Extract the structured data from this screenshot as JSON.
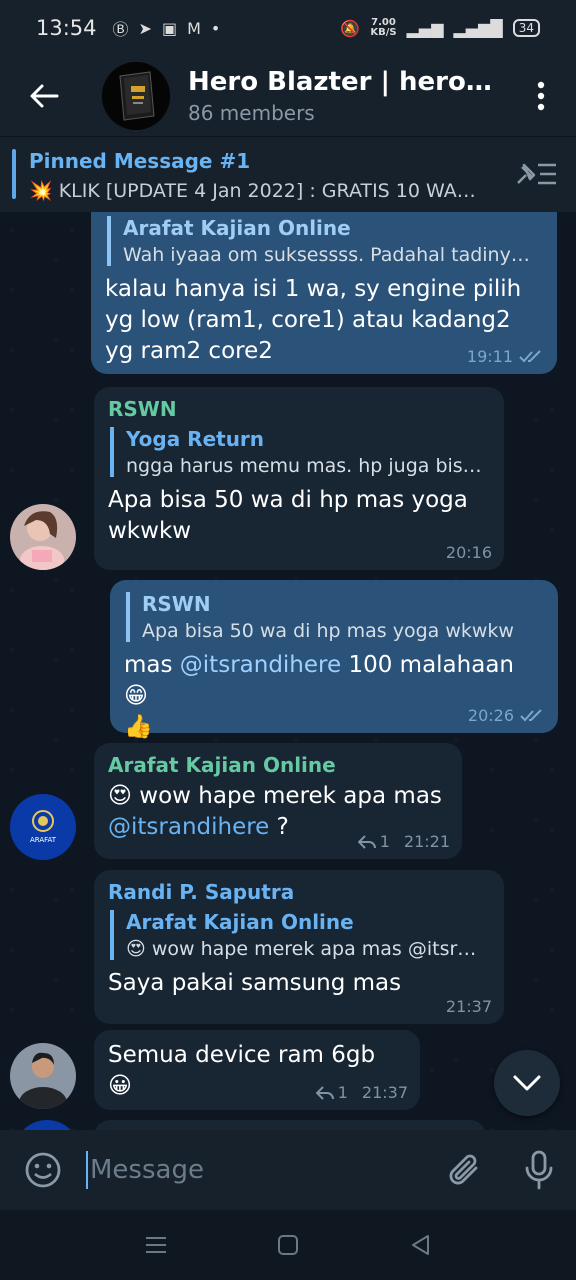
{
  "status": {
    "time": "13:54",
    "net_speed_value": "7.00",
    "net_speed_unit": "KB/S",
    "battery": "34"
  },
  "header": {
    "title": "Hero Blazter | herobla…",
    "subtitle": "86 members"
  },
  "pinned": {
    "title": "Pinned Message #1",
    "text": "💥 KLIK [UPDATE 4 Jan 2022] : GRATIS 10 WA…"
  },
  "messages": [
    {
      "reply_name": "Arafat Kajian Online",
      "reply_text": "Wah iyaaa om suksessss. Padahal tadiny…",
      "text": "kalau hanya isi 1 wa, sy engine pilih yg low (ram1, core1) atau kadang2 yg ram2 core2",
      "time": "19:11"
    },
    {
      "sender": "RSWN",
      "reply_name": "Yoga Return",
      "reply_text": "ngga harus memu mas. hp juga bis…",
      "text": "Apa bisa 50 wa di hp mas yoga wkwkw",
      "time": "20:16"
    },
    {
      "reply_name": "RSWN",
      "reply_text": "Apa bisa 50 wa di hp mas yoga wkwkw",
      "text_a": "mas ",
      "mention": "@itsrandihere",
      "text_b": " 100 malahaan 😁",
      "text_c": "👍",
      "time": "20:26"
    },
    {
      "sender": "Arafat Kajian Online",
      "text_a": "😍 wow hape merek apa mas",
      "mention": "@itsrandihere",
      "text_b": " ?",
      "replies": "1",
      "time": "21:21"
    },
    {
      "sender": "Randi P. Saputra",
      "reply_name": "Arafat Kajian Online",
      "reply_text": "😍 wow hape merek apa mas @itsr…",
      "text": "Saya pakai samsung mas",
      "time": "21:37"
    },
    {
      "text": "Semua device ram 6gb 😀",
      "replies": "1",
      "time": "21:37"
    }
  ],
  "avatars": {
    "arafat_logo_text": "ARAFAT"
  },
  "composer": {
    "placeholder": "Message"
  },
  "colors": {
    "accent": "#6ab3f3",
    "outgoing_bubble": "#2b5278",
    "incoming_bubble": "#182533",
    "background": "#0e1621",
    "sender_green": "#65c9a2",
    "sender_blue": "#6ab3f3"
  }
}
